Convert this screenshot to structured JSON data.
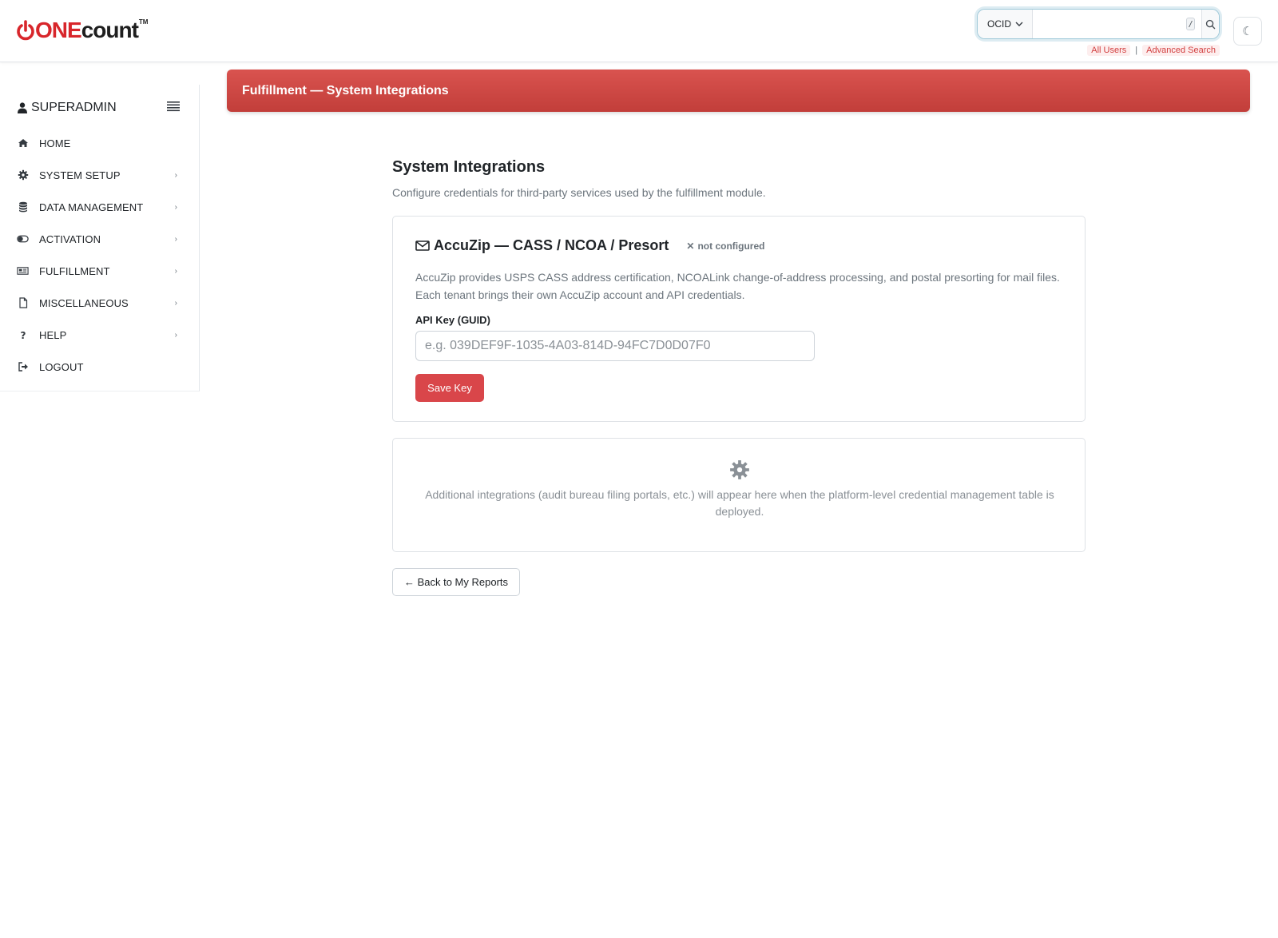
{
  "brand": {
    "logo_one": "ONE",
    "logo_count": "count",
    "logo_tm": "TM"
  },
  "search": {
    "scope_value": "OCID",
    "placeholder": "",
    "shortcut": "/"
  },
  "quick_links": {
    "all_users": "All Users",
    "separator": "|",
    "advanced_search": "Advanced Search"
  },
  "theme_toggle": {
    "glyph": "☾"
  },
  "sidebar": {
    "user": "SUPERADMIN",
    "items": [
      {
        "label": "HOME",
        "icon": "home-icon",
        "chevron": ""
      },
      {
        "label": "SYSTEM SETUP",
        "icon": "gear-icon",
        "chevron": "›"
      },
      {
        "label": "DATA MANAGEMENT",
        "icon": "database-icon",
        "chevron": "›"
      },
      {
        "label": "ACTIVATION",
        "icon": "toggle-icon",
        "chevron": "›"
      },
      {
        "label": "FULFILLMENT",
        "icon": "newspaper-icon",
        "chevron": "›"
      },
      {
        "label": "MISCELLANEOUS",
        "icon": "file-icon",
        "chevron": "›"
      },
      {
        "label": "HELP",
        "icon": "question-icon",
        "chevron": "›"
      },
      {
        "label": "LOGOUT",
        "icon": "sign-out-icon",
        "chevron": ""
      }
    ]
  },
  "banner": {
    "title": "Fulfillment — System Integrations"
  },
  "main": {
    "title": "System Integrations",
    "subtitle": "Configure credentials for third-party services used by the fulfillment module.",
    "accuzip": {
      "title": "AccuZip — CASS / NCOA / Presort",
      "status_mark": "✕",
      "status": "not configured",
      "description": "AccuZip provides USPS CASS address certification, NCOALink change-of-address processing, and postal presorting for mail files. Each tenant brings their own AccuZip account and API credentials.",
      "field_label": "API Key (GUID)",
      "field_placeholder": "e.g. 039DEF9F-1035-4A03-814D-94FC7D0D07F0",
      "save_label": "Save Key"
    },
    "placeholder_card": {
      "text": "Additional integrations (audit bureau filing portals, etc.) will appear here when the platform-level credential management table is deployed."
    },
    "back_label": "← Back to My Reports"
  },
  "colors": {
    "brand_red": "#d8262b",
    "banner_red": "#d9534f",
    "button_red": "#d9464a"
  }
}
